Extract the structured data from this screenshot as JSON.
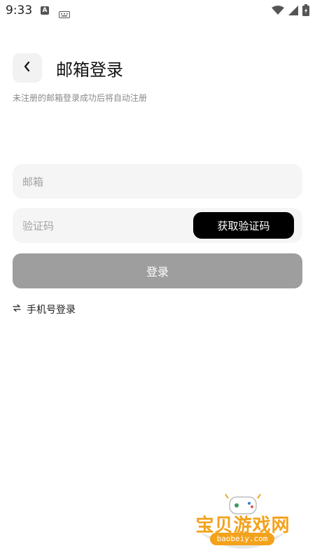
{
  "status_bar": {
    "time": "9:33",
    "notification_icons": [
      "a-icon",
      "keyboard-icon"
    ],
    "system_icons": [
      "wifi-icon",
      "signal-icon",
      "battery-icon"
    ]
  },
  "header": {
    "back_icon": "chevron-left-icon",
    "title": "邮箱登录",
    "subtitle": "未注册的邮箱登录成功后将自动注册"
  },
  "form": {
    "email_placeholder": "邮箱",
    "email_value": "",
    "code_placeholder": "验证码",
    "code_value": "",
    "get_code_label": "获取验证码",
    "login_label": "登录",
    "switch_icon": "swap-arrows-icon",
    "switch_label": "手机号登录"
  },
  "watermark": {
    "title": "宝贝游戏网",
    "site": "baobeiy.com"
  },
  "colors": {
    "background": "#ffffff",
    "field_bg": "#f5f5f5",
    "primary_button": "#000000",
    "login_button_disabled": "#9e9e9e",
    "watermark_accent": "#f3a21c"
  }
}
